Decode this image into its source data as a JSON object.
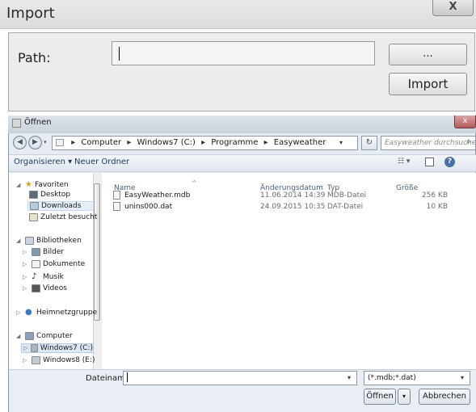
{
  "import_dialog": {
    "title": "Import",
    "close_label": "X",
    "path_label": "Path:",
    "path_value": "",
    "browse_label": "...",
    "import_label": "Import"
  },
  "open_dialog": {
    "title": "Öffnen",
    "close_label": "x",
    "address": {
      "parts": [
        "Computer",
        "Windows7 (C:)",
        "Programme",
        "Easyweather"
      ]
    },
    "search_placeholder": "Easyweather durchsuchen",
    "toolbar": {
      "organize": "Organisieren ▾",
      "new_folder": "Neuer Ordner"
    },
    "nav": [
      {
        "label": "Favoriten",
        "level": 0,
        "expanded": true
      },
      {
        "label": "Desktop",
        "level": 1
      },
      {
        "label": "Downloads",
        "level": 1,
        "selected": true
      },
      {
        "label": "Zuletzt besucht",
        "level": 1
      },
      {
        "label": "Bibliotheken",
        "level": 0,
        "expanded": true
      },
      {
        "label": "Bilder",
        "level": 1
      },
      {
        "label": "Dokumente",
        "level": 1
      },
      {
        "label": "Musik",
        "level": 1
      },
      {
        "label": "Videos",
        "level": 1
      },
      {
        "label": "Heimnetzgruppe",
        "level": 0
      },
      {
        "label": "Computer",
        "level": 0,
        "expanded": true
      },
      {
        "label": "Windows7 (C:)",
        "level": 1,
        "selected": true
      },
      {
        "label": "Windows8 (E:)",
        "level": 1
      }
    ],
    "columns": [
      "Name",
      "Änderungsdatum",
      "Typ",
      "Größe"
    ],
    "files": [
      {
        "name": "EasyWeather.mdb",
        "date": "11.06.2014 14:39",
        "type": "MDB-Datei",
        "size": "256 KB"
      },
      {
        "name": "unins000.dat",
        "date": "24.09.2015 10:35",
        "type": "DAT-Datei",
        "size": "10 KB"
      }
    ],
    "filename_label": "Dateiname:",
    "filename_value": "",
    "filetype_value": "(*.mdb;*.dat)",
    "open_label": "Öffnen",
    "cancel_label": "Abbrechen"
  }
}
